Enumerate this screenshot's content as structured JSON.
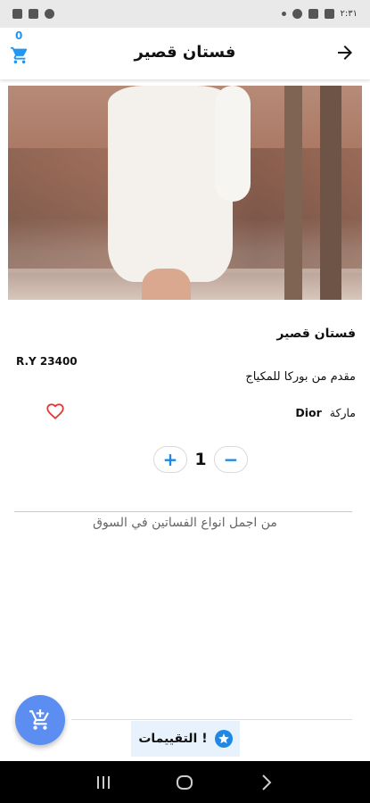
{
  "status_bar": {
    "time": "٢:٣١"
  },
  "app_bar": {
    "title": "فستان قصير",
    "cart_count": "0"
  },
  "product": {
    "name": "فستان قصير",
    "price": "R.Y 23400",
    "vendor": "مقدم من  بوركا للمكياج",
    "brand_label": "ماركة",
    "brand_value": "Dior",
    "quantity": "1",
    "description": "من اجمل انواع الفساتين في السوق"
  },
  "quantity_controls": {
    "increase": "+",
    "decrease": "−"
  },
  "ratings": {
    "label": "التقييمات !"
  },
  "colors": {
    "accent": "#1e88e5",
    "fab": "#5b8ef0",
    "favorite": "#e53935"
  },
  "icons": {
    "cart": "cart-icon",
    "back": "arrow-right-icon",
    "favorite": "heart-outline-icon",
    "add_to_cart": "add-cart-icon",
    "star": "star-icon"
  }
}
